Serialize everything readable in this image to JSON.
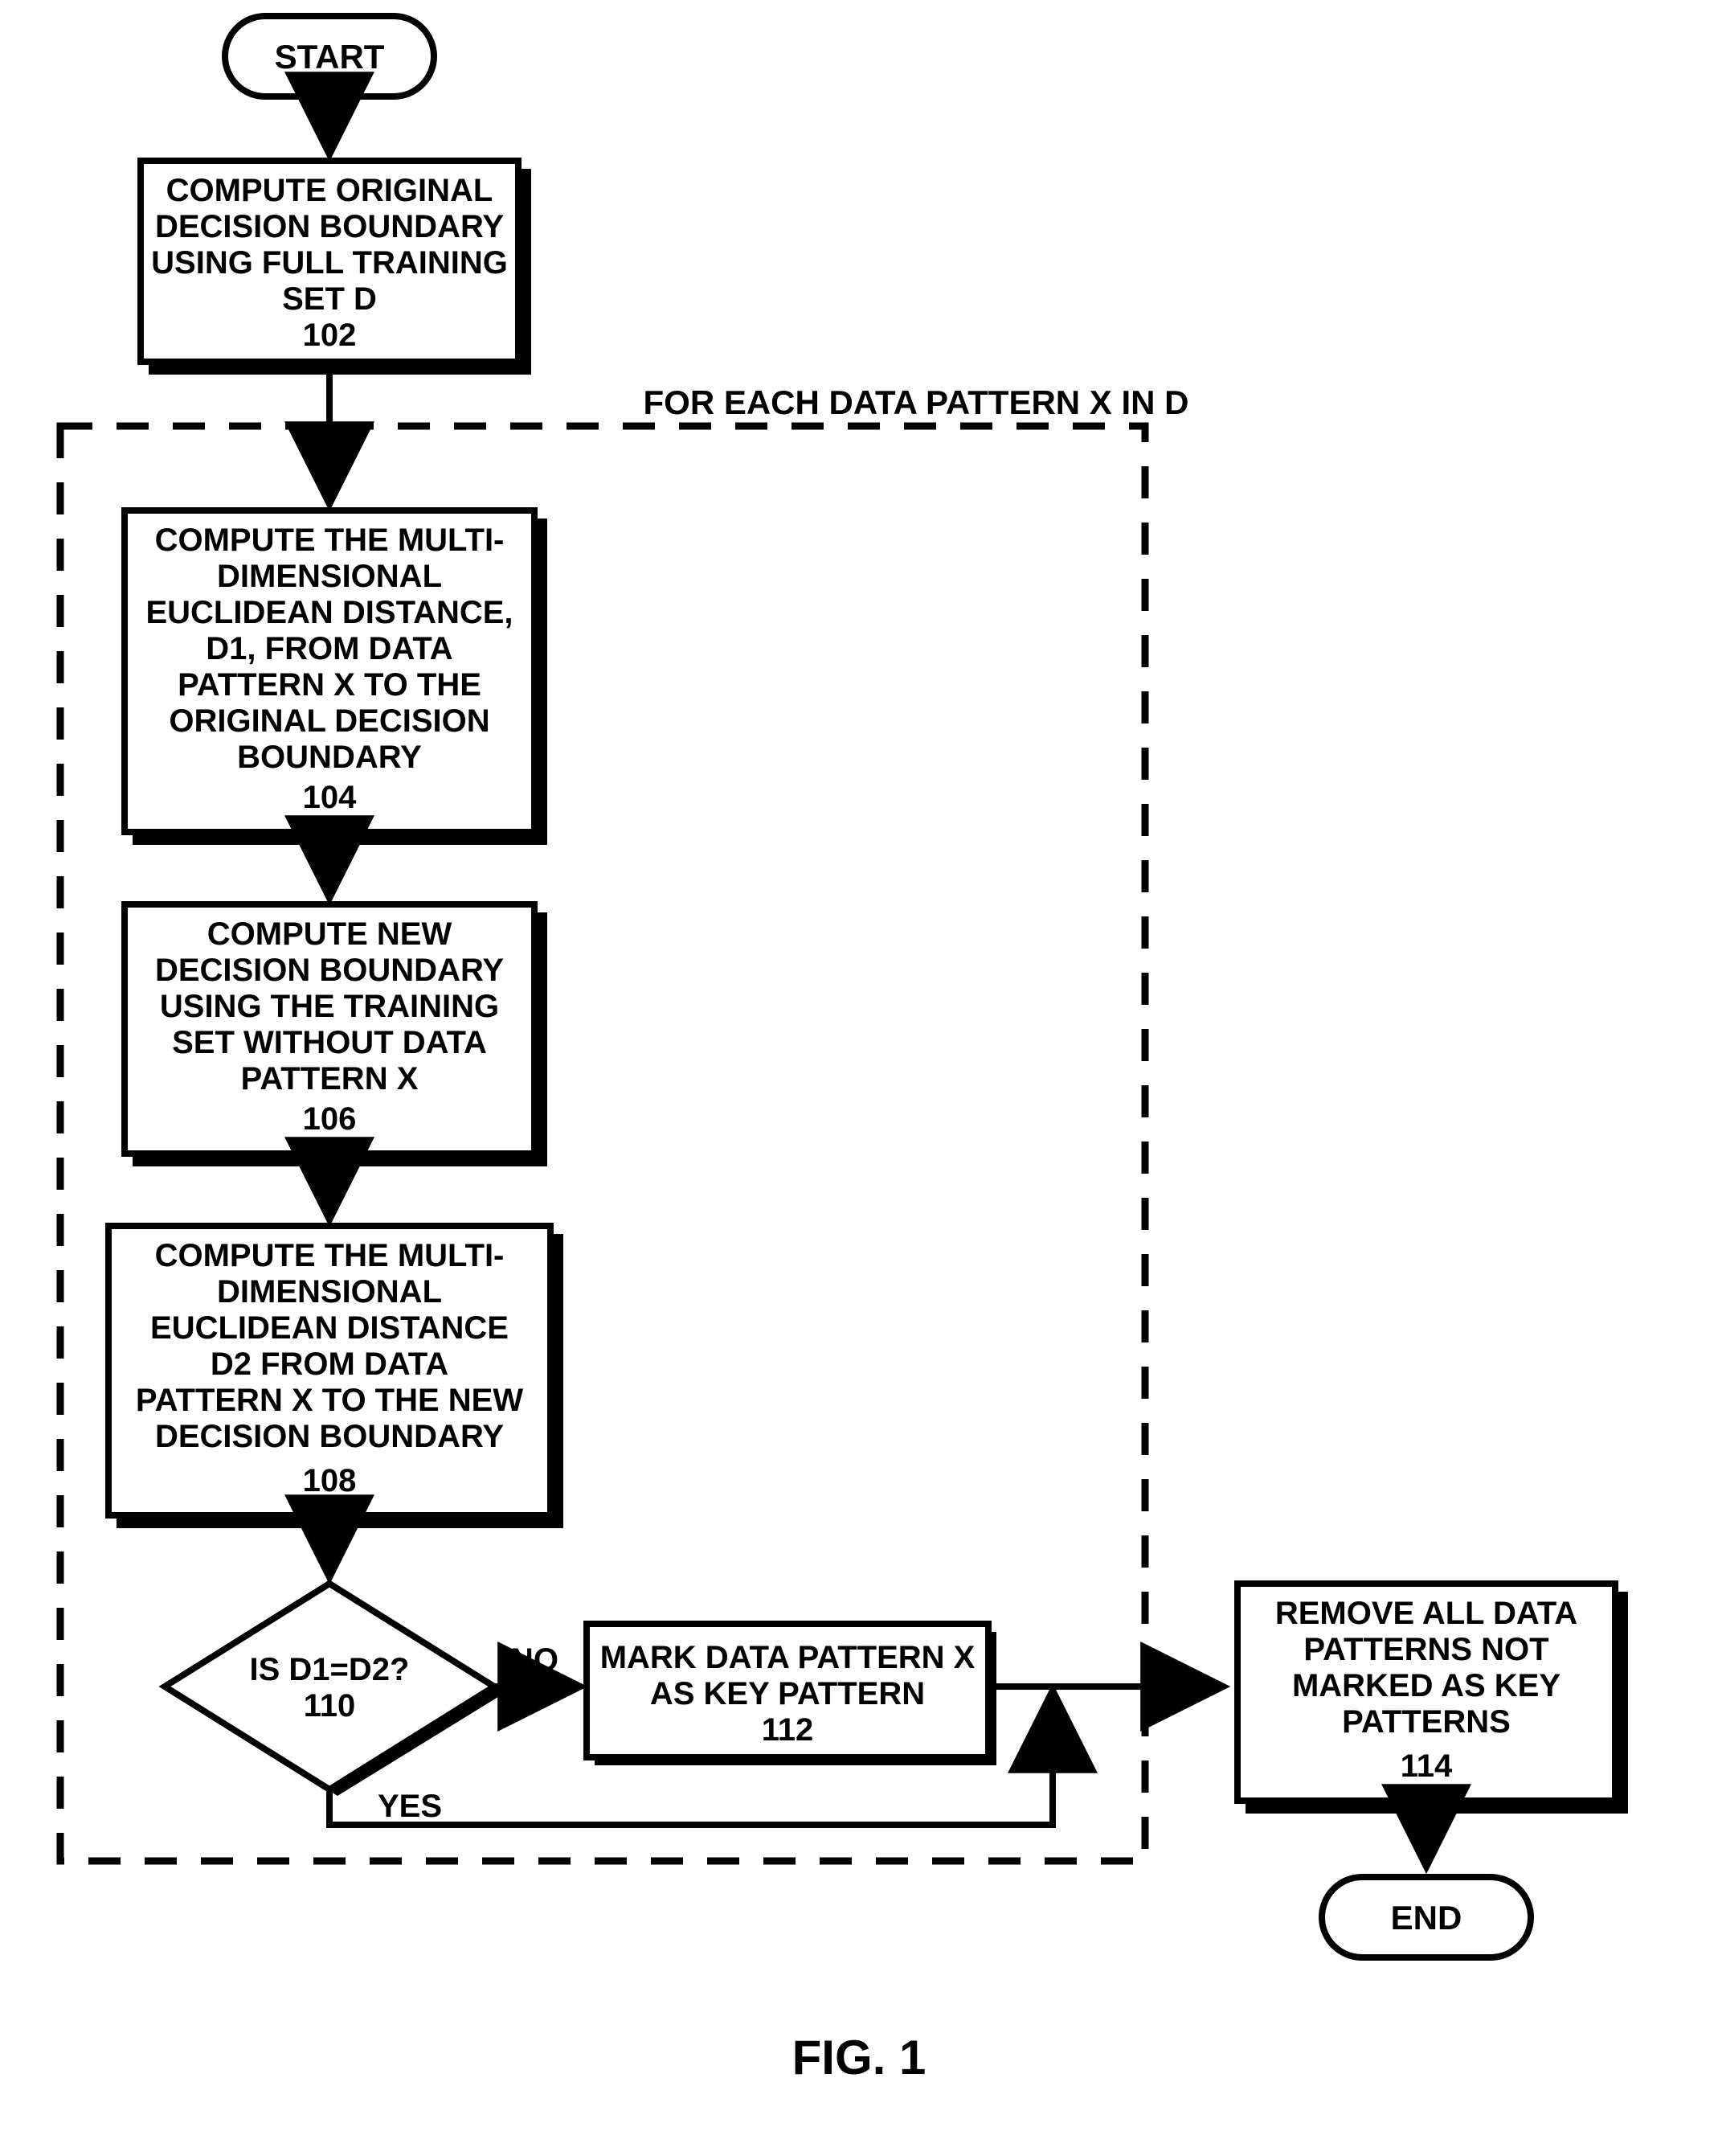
{
  "nodes": {
    "start": {
      "label": "START"
    },
    "n102": {
      "l1": "COMPUTE ORIGINAL",
      "l2": "DECISION BOUNDARY",
      "l3": "USING FULL TRAINING",
      "l4": "SET D",
      "num": "102"
    },
    "loop": {
      "label": "FOR EACH DATA PATTERN X IN D"
    },
    "n104": {
      "l1": "COMPUTE THE MULTI-",
      "l2": "DIMENSIONAL",
      "l3": "EUCLIDEAN DISTANCE,",
      "l4": "D1, FROM DATA",
      "l5": "PATTERN X TO THE",
      "l6": "ORIGINAL DECISION",
      "l7": "BOUNDARY",
      "num": "104"
    },
    "n106": {
      "l1": "COMPUTE NEW",
      "l2": "DECISION BOUNDARY",
      "l3": "USING THE TRAINING",
      "l4": "SET WITHOUT DATA",
      "l5": "PATTERN X",
      "num": "106"
    },
    "n108": {
      "l1": "COMPUTE THE MULTI-",
      "l2": "DIMENSIONAL",
      "l3": "EUCLIDEAN DISTANCE",
      "l4": "D2 FROM DATA",
      "l5": "PATTERN X TO THE NEW",
      "l6": "DECISION BOUNDARY",
      "num": "108"
    },
    "n110": {
      "l1": "IS D1=D2?",
      "num": "110"
    },
    "n112": {
      "l1": "MARK DATA PATTERN X",
      "l2": "AS KEY PATTERN",
      "num": "112"
    },
    "n114": {
      "l1": "REMOVE ALL DATA",
      "l2": "PATTERNS NOT",
      "l3": "MARKED AS KEY",
      "l4": "PATTERNS",
      "num": "114"
    },
    "end": {
      "label": "END"
    }
  },
  "edges": {
    "no": "NO",
    "yes": "YES"
  },
  "caption": "FIG. 1"
}
